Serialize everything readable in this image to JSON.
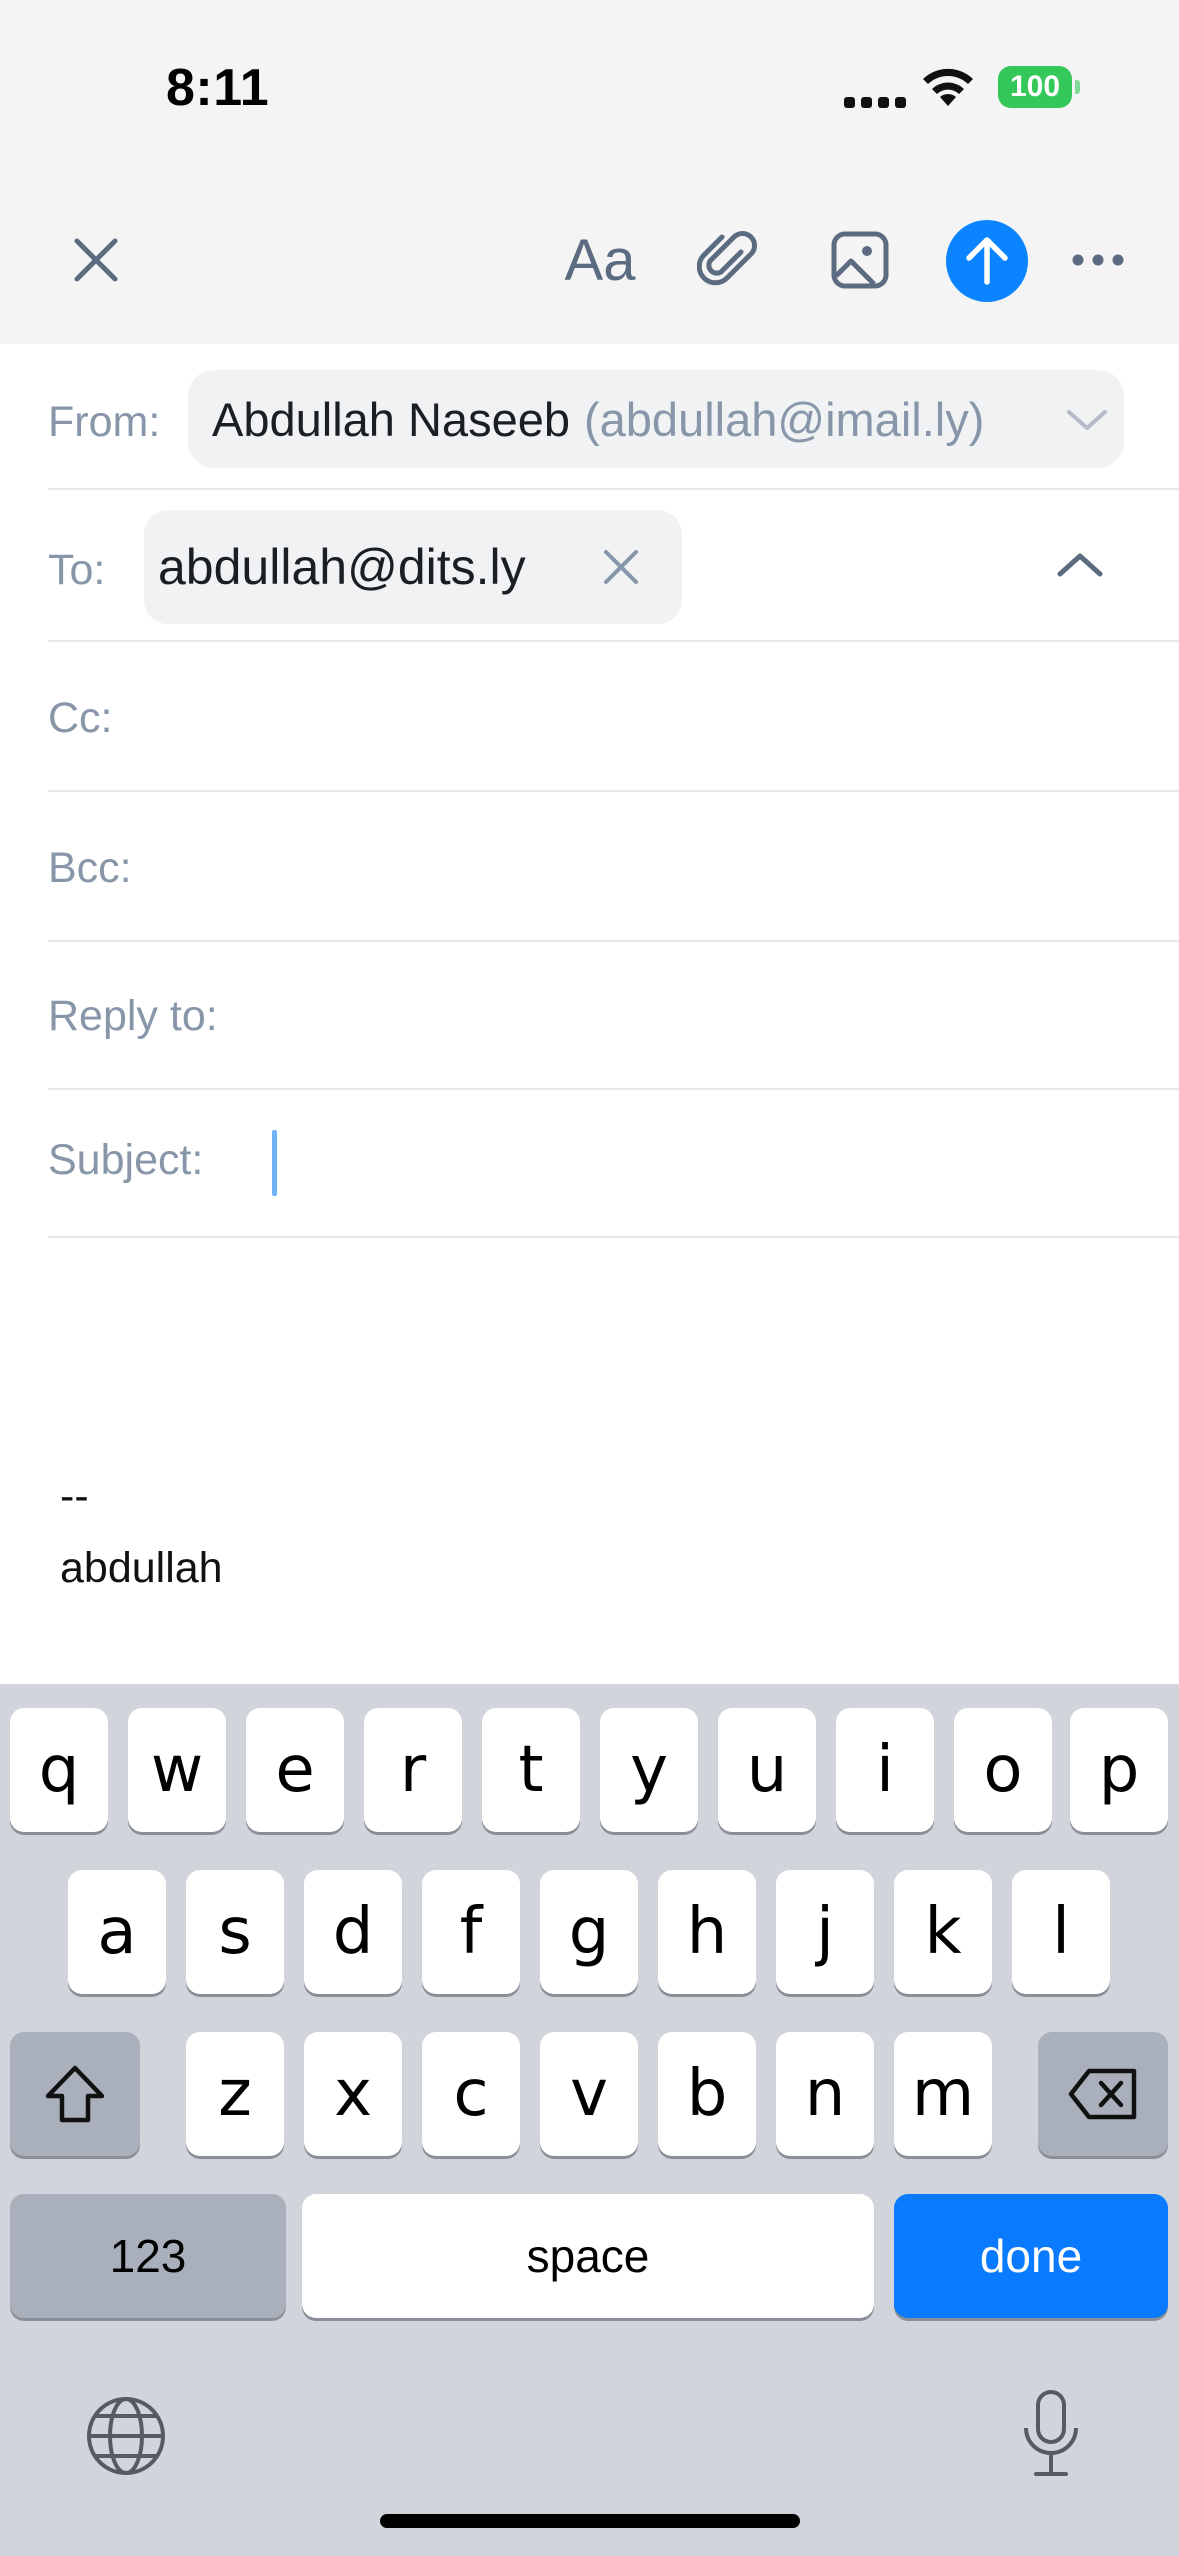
{
  "status_bar": {
    "time": "8:11",
    "battery": "100"
  },
  "toolbar": {
    "font_label": "Aa",
    "icons": [
      "close-icon",
      "font-icon",
      "paperclip-icon",
      "image-icon",
      "send-arrow-icon",
      "more-icon"
    ],
    "accent_color": "#0a84ff"
  },
  "compose": {
    "from": {
      "label": "From:",
      "name": "Abdullah Naseeb",
      "email": "(abdullah@imail.ly)"
    },
    "to": {
      "label": "To:",
      "recipient": "abdullah@dits.ly"
    },
    "cc": {
      "label": "Cc:"
    },
    "bcc": {
      "label": "Bcc:"
    },
    "reply_to": {
      "label": "Reply to:"
    },
    "subject": {
      "label": "Subject:",
      "value": ""
    },
    "signature": {
      "separator": "--",
      "name": "abdullah"
    }
  },
  "keyboard": {
    "row1": [
      "q",
      "w",
      "e",
      "r",
      "t",
      "y",
      "u",
      "i",
      "o",
      "p"
    ],
    "row2": [
      "a",
      "s",
      "d",
      "f",
      "g",
      "h",
      "j",
      "k",
      "l"
    ],
    "row3": [
      "z",
      "x",
      "c",
      "v",
      "b",
      "n",
      "m"
    ],
    "numbers_label": "123",
    "space_label": "space",
    "done_label": "done"
  }
}
